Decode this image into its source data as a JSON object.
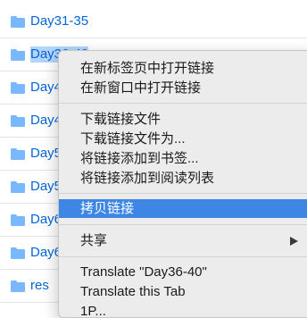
{
  "files": [
    {
      "name": "Day31-35",
      "icon": "folder-icon"
    },
    {
      "name": "Day36-40",
      "icon": "folder-icon",
      "selected": true
    },
    {
      "name": "Day41-45",
      "icon": "folder-icon"
    },
    {
      "name": "Day46-50",
      "icon": "folder-icon"
    },
    {
      "name": "Day51-55",
      "icon": "folder-icon"
    },
    {
      "name": "Day56-60",
      "icon": "folder-icon"
    },
    {
      "name": "Day61-65",
      "icon": "folder-icon"
    },
    {
      "name": "Day66-70",
      "icon": "folder-icon"
    },
    {
      "name": "res",
      "icon": "folder-icon"
    }
  ],
  "context_menu": {
    "open_in_new_tab": "在新标签页中打开链接",
    "open_in_new_window": "在新窗口中打开链接",
    "download_link": "下载链接文件",
    "download_link_as": "下载链接文件为...",
    "add_link_to_bookmarks": "将链接添加到书签...",
    "add_link_to_reading_list": "将链接添加到阅读列表",
    "copy_link": "拷贝链接",
    "share": "共享",
    "translate_selection": "Translate \"Day36-40\"",
    "translate_tab": "Translate this Tab",
    "partial_next": "1P..."
  },
  "colors": {
    "link": "#0366d6",
    "folder": "#79b8ff",
    "selection": "#b3d4fc",
    "menu_highlight": "#3d86e3",
    "menu_bg": "#ececec"
  }
}
